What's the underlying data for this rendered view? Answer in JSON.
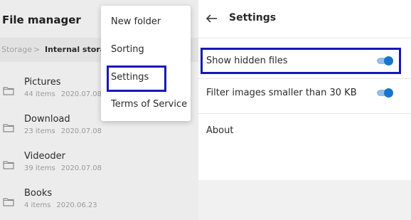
{
  "file_manager": {
    "title": "File manager",
    "breadcrumb": {
      "storage": "Storage",
      "separator": ">",
      "current": "Internal storage"
    },
    "folders": [
      {
        "name": "Pictures",
        "count": "44 items",
        "date": "2020.07.08"
      },
      {
        "name": "Download",
        "count": "23 items",
        "date": "2020.07.08"
      },
      {
        "name": "Videoder",
        "count": "39 items",
        "date": "2020.07.08"
      },
      {
        "name": "Books",
        "count": "4 items",
        "date": "2020.06.23"
      }
    ],
    "menu": {
      "items": [
        "New folder",
        "Sorting",
        "Settings",
        "Terms of Service"
      ],
      "highlighted": "Settings"
    }
  },
  "settings": {
    "title": "Settings",
    "items": [
      {
        "label": "Show hidden files",
        "toggle": true
      },
      {
        "label": "Filter images smaller than 30 KB",
        "toggle": true
      },
      {
        "label": "About"
      }
    ]
  },
  "colors": {
    "highlight_box": "#1818b8",
    "toggle_on": "#1a73cd",
    "panel_bg": "#ececec"
  }
}
